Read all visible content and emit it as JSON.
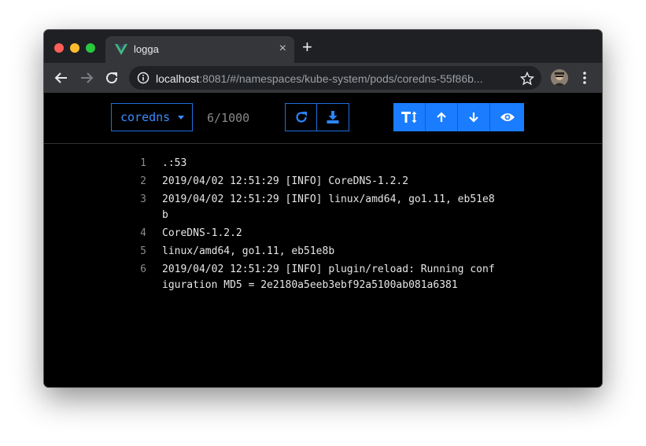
{
  "browser": {
    "tab_title": "logga",
    "tab_close": "×",
    "new_tab": "+",
    "url_host": "localhost",
    "url_path": ":8081/#/namespaces/kube-system/pods/coredns-55f86b..."
  },
  "app": {
    "pod_name": "coredns",
    "line_count": "6/1000",
    "actions": [
      "refresh-icon",
      "download-icon"
    ],
    "toggles": [
      "text-size-icon",
      "arrow-up-icon",
      "arrow-down-icon",
      "eye-icon"
    ]
  },
  "log": [
    {
      "num": "1",
      "text": ".:53"
    },
    {
      "num": "2",
      "text": "2019/04/02 12:51:29 [INFO] CoreDNS-1.2.2"
    },
    {
      "num": "3",
      "text": "2019/04/02 12:51:29 [INFO] linux/amd64, go1.11, eb51e8b"
    },
    {
      "num": "4",
      "text": "CoreDNS-1.2.2"
    },
    {
      "num": "5",
      "text": "linux/amd64, go1.11, eb51e8b"
    },
    {
      "num": "6",
      "text": "2019/04/02 12:51:29 [INFO] plugin/reload: Running configuration MD5 = 2e2180a5eeb3ebf92a5100ab081a6381"
    }
  ],
  "colors": {
    "accent": "#1a7cff",
    "window_bg": "#000000",
    "chrome_tab_strip": "#1f2023",
    "chrome_toolbar": "#35363a"
  }
}
